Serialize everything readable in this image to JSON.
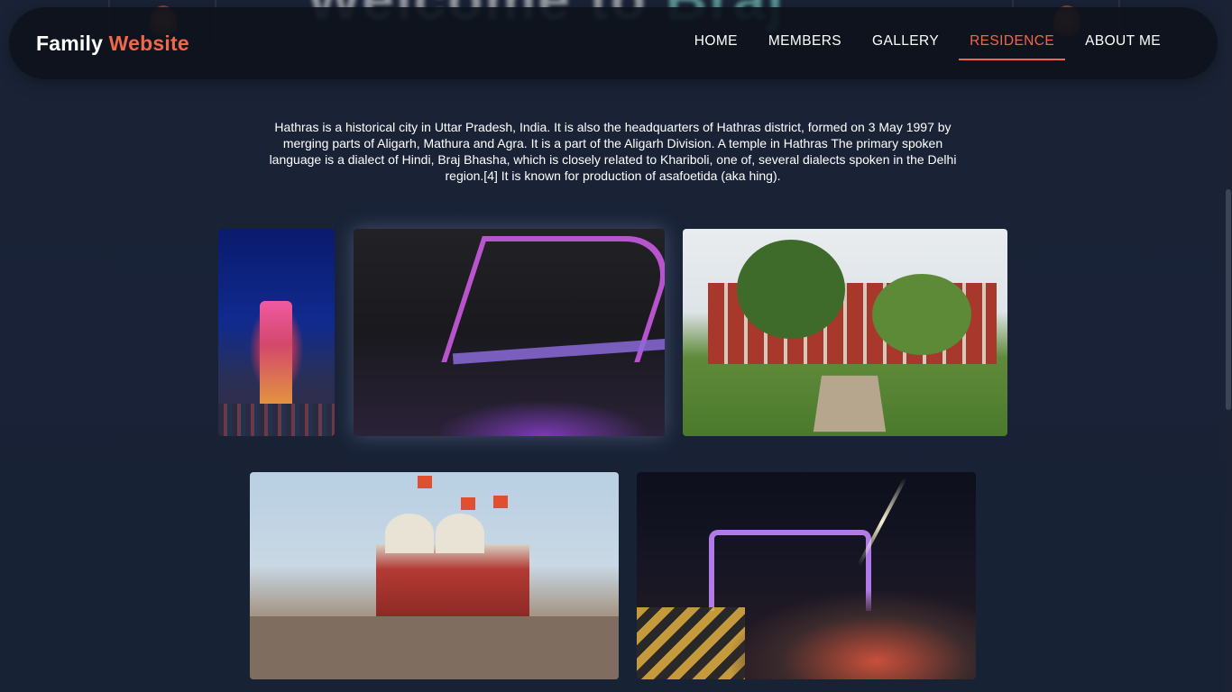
{
  "hero": {
    "ghost_text_a": "Welcome to ",
    "ghost_text_b": "Braj"
  },
  "navbar": {
    "brand_part1": "Family",
    "brand_part2": "Website",
    "items": [
      {
        "label": "HOME",
        "active": false
      },
      {
        "label": "MEMBERS",
        "active": false
      },
      {
        "label": "GALLERY",
        "active": false
      },
      {
        "label": "RESIDENCE",
        "active": true
      },
      {
        "label": "ABOUT ME",
        "active": false
      }
    ]
  },
  "residence": {
    "description": "Hathras is a historical city in Uttar Pradesh, India. It is also the headquarters of Hathras district, formed on 3 May 1997 by merging parts of Aligarh, Mathura and Agra. It is a part of the Aligarh Division. A temple in Hathras The primary spoken language is a dialect of Hindi, Braj Bhasha, which is closely related to Khariboli, one of, several dialects spoken in the Delhi region.[4] It is known for production of asafoetida (aka hing)."
  },
  "colors": {
    "background": "#172033",
    "navbar": "#0d121c",
    "accent": "#f0674a",
    "text": "#ffffff"
  }
}
